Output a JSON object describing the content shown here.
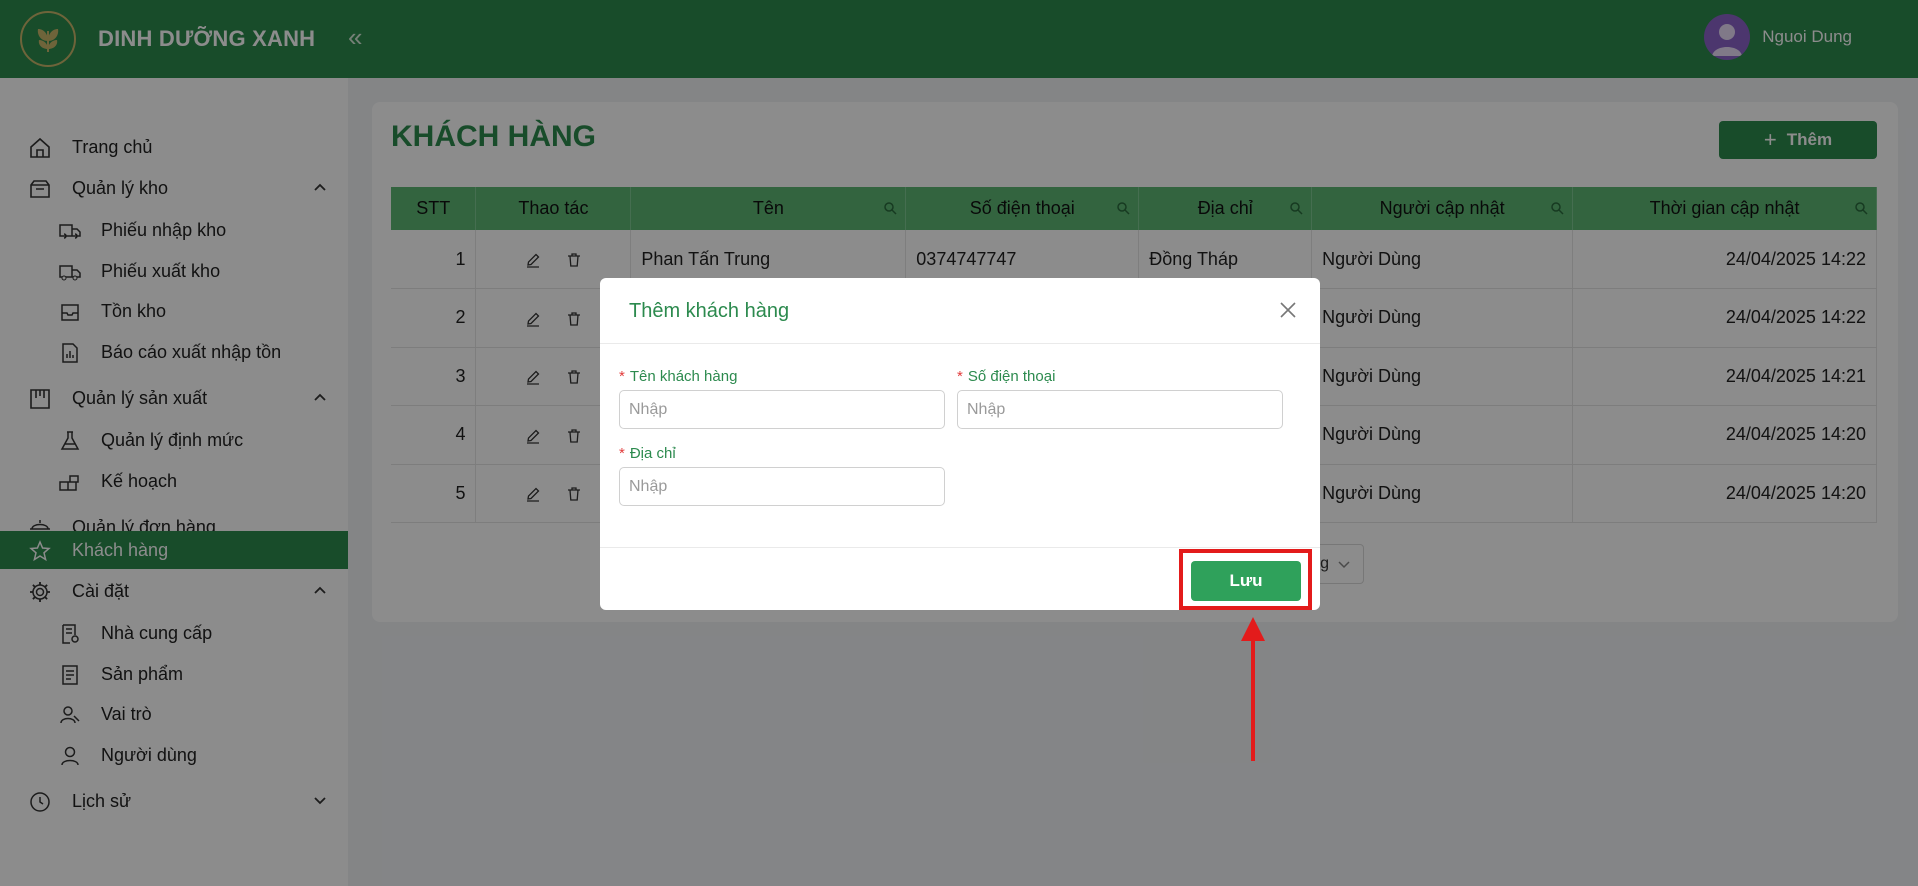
{
  "header": {
    "brand": "DINH DƯỠNG XANH",
    "collapse": "«",
    "user_name": "Nguoi Dung"
  },
  "sidebar": {
    "items": [
      {
        "label": "Trang chủ",
        "icon": "home-icon"
      },
      {
        "label": "Quản lý kho",
        "icon": "box-icon",
        "expanded": true
      },
      {
        "label": "Phiếu nhập kho",
        "icon": "truck-in-icon"
      },
      {
        "label": "Phiếu xuất kho",
        "icon": "truck-out-icon"
      },
      {
        "label": "Tồn kho",
        "icon": "inbox-icon"
      },
      {
        "label": "Báo cáo xuất nhập tồn",
        "icon": "report-icon"
      },
      {
        "label": "Quản lý sản xuất",
        "icon": "factory-icon",
        "expanded": true
      },
      {
        "label": "Quản lý định mức",
        "icon": "flask-icon"
      },
      {
        "label": "Kế hoạch",
        "icon": "blocks-icon"
      },
      {
        "label": "Quản lý đơn hàng",
        "icon": "order-icon"
      },
      {
        "label": "Khách hàng",
        "icon": "star-icon",
        "active": true
      },
      {
        "label": "Cài đặt",
        "icon": "gear-icon",
        "expanded": true
      },
      {
        "label": "Nhà cung cấp",
        "icon": "supplier-icon"
      },
      {
        "label": "Sản phẩm",
        "icon": "product-icon"
      },
      {
        "label": "Vai trò",
        "icon": "role-icon"
      },
      {
        "label": "Người dùng",
        "icon": "user-icon"
      },
      {
        "label": "Lịch sử",
        "icon": "history-icon",
        "expanded": false
      }
    ]
  },
  "main": {
    "title": "KHÁCH HÀNG",
    "add_label": "Thêm",
    "columns": [
      "STT",
      "Thao tác",
      "Tên",
      "Số điện thoại",
      "Địa chỉ",
      "Người cập nhật",
      "Thời gian cập nhật"
    ],
    "rows": [
      {
        "stt": "1",
        "name": "Phan Tấn Trung",
        "phone": "0374747747",
        "address": "Đồng Tháp",
        "updater": "Người Dùng",
        "time": "24/04/2025 14:22"
      },
      {
        "stt": "2",
        "name": "",
        "phone": "",
        "address": "",
        "updater": "Người Dùng",
        "time": "24/04/2025 14:22"
      },
      {
        "stt": "3",
        "name": "",
        "phone": "",
        "address": "",
        "updater": "Người Dùng",
        "time": "24/04/2025 14:21"
      },
      {
        "stt": "4",
        "name": "",
        "phone": "",
        "address": "",
        "updater": "Người Dùng",
        "time": "24/04/2025 14:20"
      },
      {
        "stt": "5",
        "name": "",
        "phone": "",
        "address": "",
        "updater": "Người Dùng",
        "time": "24/04/2025 14:20"
      }
    ],
    "pager_text": "g"
  },
  "modal": {
    "title": "Thêm khách hàng",
    "fields": {
      "name": {
        "label": "Tên khách hàng",
        "placeholder": "Nhập"
      },
      "phone": {
        "label": "Số điện thoại",
        "placeholder": "Nhập"
      },
      "address": {
        "label": "Địa chỉ",
        "placeholder": "Nhập"
      }
    },
    "required_mark": "*",
    "save_label": "Lưu"
  },
  "colors": {
    "brand_green": "#2c8a4e",
    "table_header": "#5db774",
    "save_button": "#2fa15b",
    "highlight": "#e31b1b"
  }
}
